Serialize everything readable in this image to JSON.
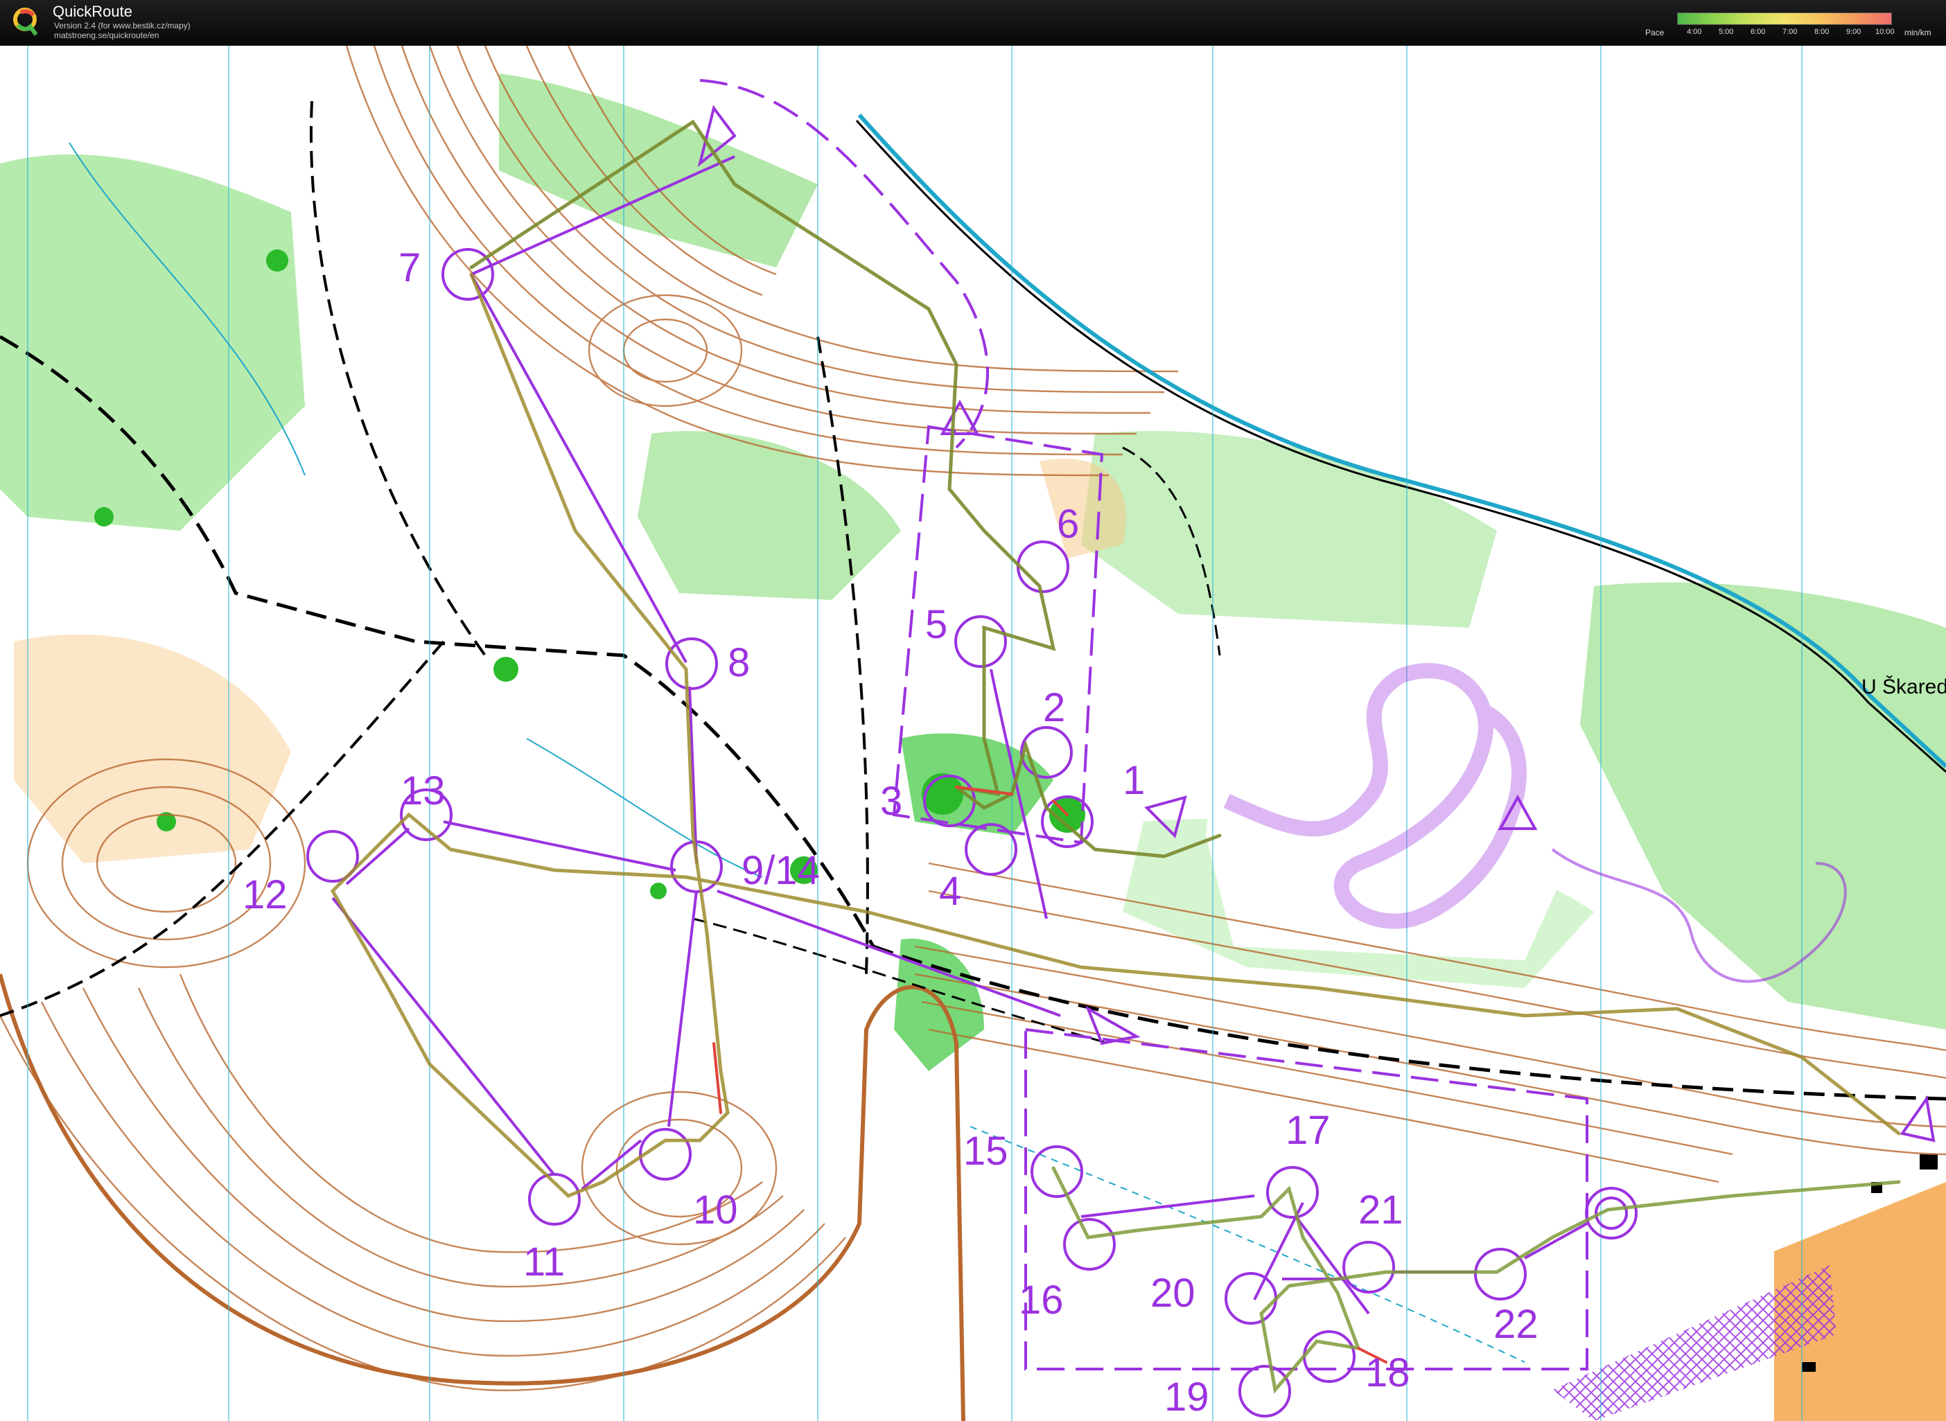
{
  "app": {
    "title": "QuickRoute",
    "version": "Version 2.4  (for www.bestik.cz/mapy)",
    "url": "matstroeng.se/quickroute/en"
  },
  "pace_legend": {
    "label": "Pace",
    "ticks": [
      "4:00",
      "5:00",
      "6:00",
      "7:00",
      "8:00",
      "9:00",
      "10:00"
    ],
    "unit": "min/km",
    "colors": [
      "#4db848",
      "#8fd24e",
      "#c8e05c",
      "#f2e26a",
      "#f6c25e",
      "#f39a5d",
      "#ef6e6e"
    ]
  },
  "map": {
    "place_label": "U Škared",
    "colors": {
      "course": "#9b32e0",
      "contour": "#b8672e",
      "vegetation": "#3cc83c",
      "open_land": "#f8c784",
      "water": "#1fa7c9",
      "track": "#000000"
    },
    "controls": [
      {
        "label": "1"
      },
      {
        "label": "2"
      },
      {
        "label": "3"
      },
      {
        "label": "4"
      },
      {
        "label": "5"
      },
      {
        "label": "6"
      },
      {
        "label": "7"
      },
      {
        "label": "8"
      },
      {
        "label": "9/14"
      },
      {
        "label": "10"
      },
      {
        "label": "11"
      },
      {
        "label": "12"
      },
      {
        "label": "13"
      },
      {
        "label": "15"
      },
      {
        "label": "16"
      },
      {
        "label": "17"
      },
      {
        "label": "18"
      },
      {
        "label": "19"
      },
      {
        "label": "20"
      },
      {
        "label": "21"
      },
      {
        "label": "22"
      }
    ]
  }
}
